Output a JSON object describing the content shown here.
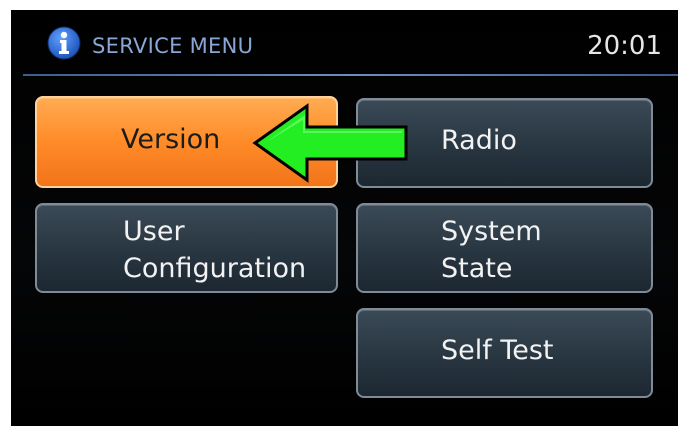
{
  "header": {
    "icon": "info-icon",
    "title": "SERVICE MENU",
    "time": "20:01"
  },
  "menu": {
    "version": {
      "label": "Version",
      "active": true
    },
    "radio": {
      "label": "Radio"
    },
    "user_configuration": {
      "line1": "User",
      "line2": "Configuration"
    },
    "system_state": {
      "line1": "System",
      "line2": "State"
    },
    "self_test": {
      "label": "Self Test"
    }
  },
  "annotation": {
    "icon": "green-arrow-icon"
  },
  "colors": {
    "active_button": "#ff8b28",
    "header_title": "#8aa6d4",
    "arrow": "#22ee22",
    "info_icon": "#2f6fd8"
  }
}
